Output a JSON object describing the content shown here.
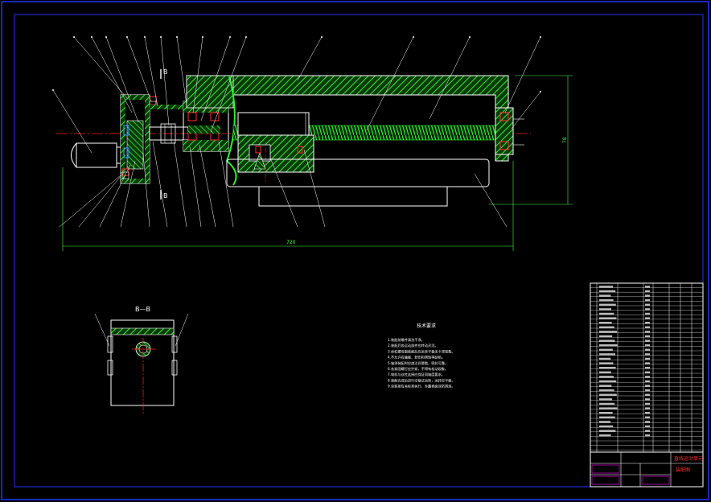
{
  "drawing": {
    "section_label": "B—B",
    "section_mark_top": "B",
    "section_mark_bottom": "B",
    "dim_width": "720",
    "dim_height": "78",
    "tech_title": "技术要求",
    "tech_lines": [
      "1.装配前零件清洗干净。",
      "2.装配后各运动部件应转动灵活。",
      "3.丝杠螺母副装配后应运转平稳无卡滞现象。",
      "4.不允许有磕碰、划伤和锈蚀等缺陷。",
      "5.轴承装配时应加注润滑脂，密封可靠。",
      "6.各紧固螺钉应拧紧，不得有松动现象。",
      "7.电机与丝杠连接应保证同轴度要求。",
      "8.装配完成后进行空载试运转，运转应平稳。",
      "9.涂装按有关标准执行，外露表面涂防锈漆。"
    ],
    "title_block": {
      "drawing_title": "直线运动单元",
      "drawing_subtitle": "装配图"
    }
  },
  "colors": {
    "hatch": "#33ee33",
    "outline": "#ffffff",
    "dim": "#44ff44",
    "centerline": "#ff2020",
    "bearing": "#ff3030",
    "accent": "#3399ff",
    "frame": "#2233ff",
    "title_text": "#ff00ff"
  }
}
